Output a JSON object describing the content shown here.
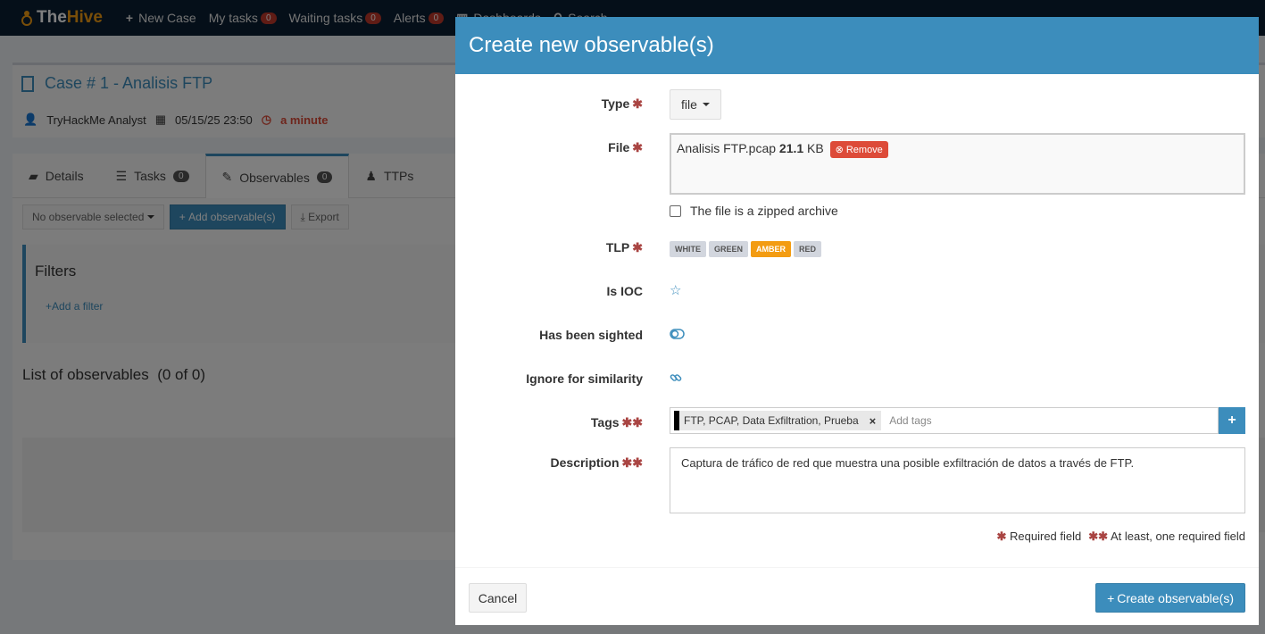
{
  "colors": {
    "primary": "#3c8dbc",
    "danger": "#dd4b39",
    "amber": "#f39c12",
    "navbar": "#0a1f33"
  },
  "navbar": {
    "brand_a": "The",
    "brand_b": "Hive",
    "new_case": "New Case",
    "my_tasks": "My tasks",
    "my_tasks_count": "0",
    "waiting_tasks": "Waiting tasks",
    "waiting_tasks_count": "0",
    "alerts": "Alerts",
    "alerts_count": "0",
    "dashboards": "Dashboards",
    "search": "Search"
  },
  "case": {
    "title": "Case # 1 - Analisis FTP",
    "author": "TryHackMe Analyst",
    "date": "05/15/25 23:50",
    "age": "a minute"
  },
  "tabs": [
    {
      "label": "Details",
      "icon": "folder-icon"
    },
    {
      "label": "Tasks",
      "count": "0",
      "icon": "list-icon"
    },
    {
      "label": "Observables",
      "count": "0",
      "icon": "pin-icon"
    },
    {
      "label": "TTPs",
      "icon": "chess-icon"
    }
  ],
  "toolbar": {
    "selection": "No observable selected",
    "add": "Add observable(s)",
    "export": "Export"
  },
  "filters": {
    "title": "Filters",
    "add": "Add a filter"
  },
  "list_title": "List of observables  (0 of 0)",
  "modal": {
    "title": "Create new observable(s)",
    "type_label": "Type",
    "type_value": "file",
    "file_label": "File",
    "file_name": "Analisis FTP.pcap",
    "file_size": "21.1",
    "file_unit": "KB",
    "remove": "Remove",
    "zipped_label": "The file is a zipped archive",
    "tlp_label": "TLP",
    "tlp": [
      "WHITE",
      "GREEN",
      "AMBER",
      "RED"
    ],
    "tlp_selected": "AMBER",
    "ioc_label": "Is IOC",
    "sighted_label": "Has been sighted",
    "ignore_label": "Ignore for similarity",
    "tags_label": "Tags",
    "tag_value": "FTP, PCAP, Data Exfiltration, Prueba",
    "tags_placeholder": "Add tags",
    "desc_label": "Description",
    "desc_value": "Captura de tráfico de red que muestra una posible exfiltración de datos a través de FTP.",
    "legend_required": "Required field",
    "legend_one": "At least, one required field",
    "cancel": "Cancel",
    "create": "Create observable(s)"
  }
}
